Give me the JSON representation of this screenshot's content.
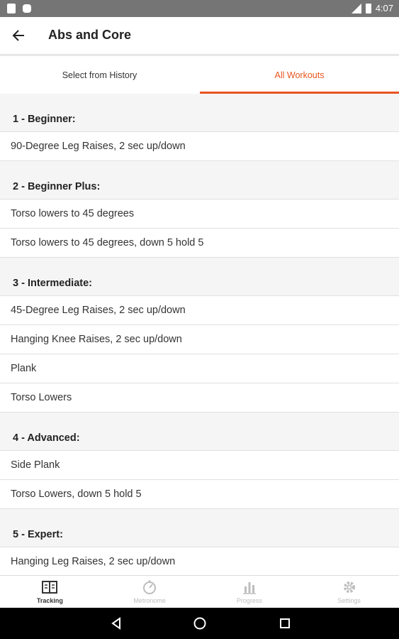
{
  "status_bar": {
    "time": "4:07"
  },
  "app_bar": {
    "title": "Abs and Core"
  },
  "tabs": [
    {
      "label": "Select from History"
    },
    {
      "label": "All Workouts",
      "active": true
    }
  ],
  "accent_color": "#e8541e",
  "sections": [
    {
      "header": "1 - Beginner:",
      "items": [
        "90-Degree Leg Raises, 2 sec up/down"
      ]
    },
    {
      "header": "2 - Beginner Plus:",
      "items": [
        "Torso lowers to 45 degrees",
        "Torso lowers to 45 degrees, down 5 hold 5"
      ]
    },
    {
      "header": "3 - Intermediate:",
      "items": [
        "45-Degree Leg Raises, 2 sec up/down",
        "Hanging Knee Raises, 2 sec up/down",
        "Plank",
        "Torso Lowers"
      ]
    },
    {
      "header": "4 - Advanced:",
      "items": [
        "Side Plank",
        "Torso Lowers, down 5 hold 5"
      ]
    },
    {
      "header": "5 - Expert:",
      "items": [
        "Hanging Leg Raises, 2 sec up/down"
      ]
    }
  ],
  "bottom_nav": [
    {
      "label": "Tracking",
      "icon": "tracking-icon",
      "active": true
    },
    {
      "label": "Metronome",
      "icon": "metronome-icon"
    },
    {
      "label": "Progress",
      "icon": "progress-icon"
    },
    {
      "label": "Settings",
      "icon": "settings-icon"
    }
  ]
}
